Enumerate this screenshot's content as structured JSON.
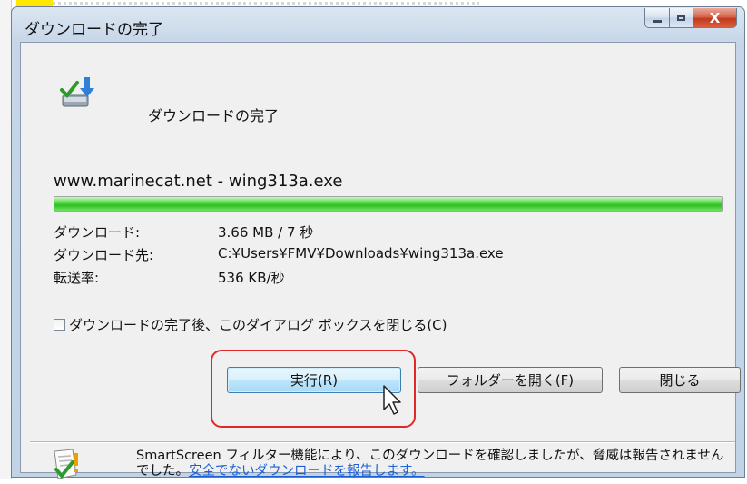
{
  "window": {
    "title": "ダウンロードの完了",
    "controls": {
      "minimize_icon": "minimize-icon",
      "maximize_icon": "maximize-icon",
      "close_label": "X"
    }
  },
  "header": {
    "title": "ダウンロードの完了",
    "icon": "download-complete-icon"
  },
  "download": {
    "source": "www.marinecat.net - wing313a.exe",
    "progress_fraction": 1.0,
    "rows": [
      {
        "label": "ダウンロード:",
        "value": "3.66 MB / 7 秒"
      },
      {
        "label": "ダウンロード先:",
        "value": "C:¥Users¥FMV¥Downloads¥wing313a.exe"
      },
      {
        "label": "転送率:",
        "value": "536 KB/秒"
      }
    ]
  },
  "close_on_complete": {
    "label": "ダウンロードの完了後、このダイアログ ボックスを閉じる(C)",
    "checked": false
  },
  "buttons": {
    "run": "実行(R)",
    "open_folder": "フォルダーを開く(F)",
    "close": "閉じる"
  },
  "smartscreen": {
    "icon": "smartscreen-shield-icon",
    "text": "SmartScreen フィルター機能により、このダウンロードを確認しましたが、脅威は報告されませんでした。",
    "link": "安全でないダウンロードを報告します。"
  },
  "colors": {
    "annotation": "#e02828",
    "progress": "#2fbf22",
    "link": "#1a5fd6"
  }
}
